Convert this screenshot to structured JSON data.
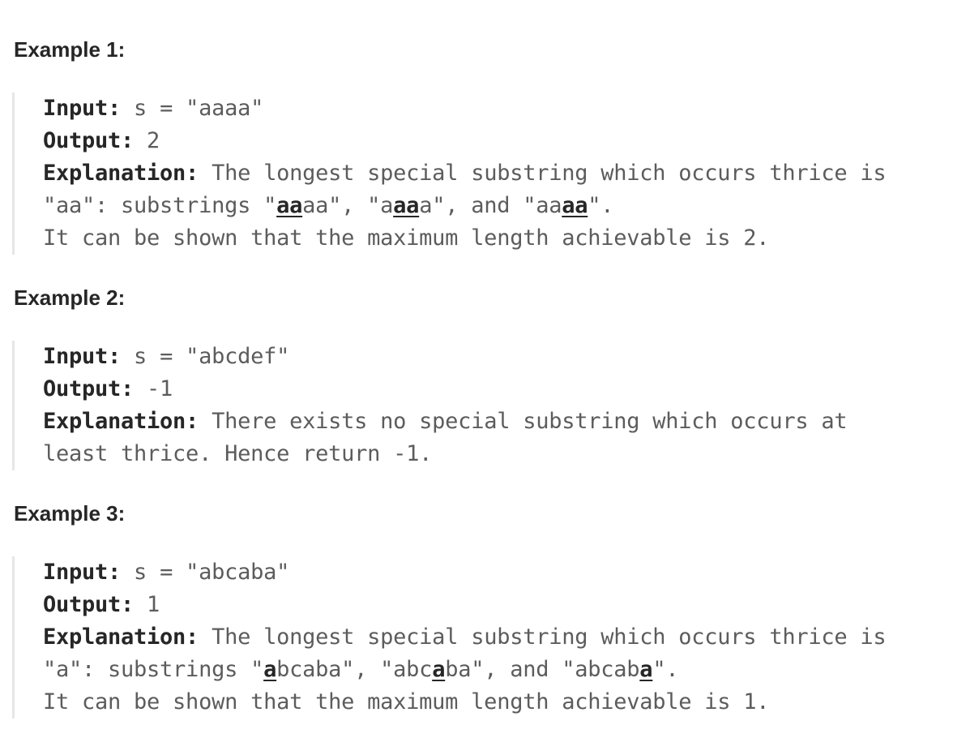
{
  "examples": [
    {
      "title": "Example 1:",
      "input_label": "Input:",
      "input_value": " s = \"aaaa\"",
      "output_label": "Output:",
      "output_value": " 2",
      "explanation_label": "Explanation:",
      "explanation_line1": " The longest special substring which occurs thrice is",
      "explanation_line2_parts": [
        "\"aa\": substrings \"",
        "aa",
        "aa\", \"a",
        "aa",
        "a\", and \"aa",
        "aa",
        "\"."
      ],
      "explanation_line3": "It can be shown that the maximum length achievable is 2."
    },
    {
      "title": "Example 2:",
      "input_label": "Input:",
      "input_value": " s = \"abcdef\"",
      "output_label": "Output:",
      "output_value": " -1",
      "explanation_label": "Explanation:",
      "explanation_line1": " There exists no special substring which occurs at",
      "explanation_line2": "least thrice. Hence return -1."
    },
    {
      "title": "Example 3:",
      "input_label": "Input:",
      "input_value": " s = \"abcaba\"",
      "output_label": "Output:",
      "output_value": " 1",
      "explanation_label": "Explanation:",
      "explanation_line1": " The longest special substring which occurs thrice is",
      "explanation_line2_parts": [
        "\"a\": substrings \"",
        "a",
        "bcaba\", \"abc",
        "a",
        "ba\", and \"abcab",
        "a",
        "\"."
      ],
      "explanation_line3": "It can be shown that the maximum length achievable is 1."
    }
  ]
}
